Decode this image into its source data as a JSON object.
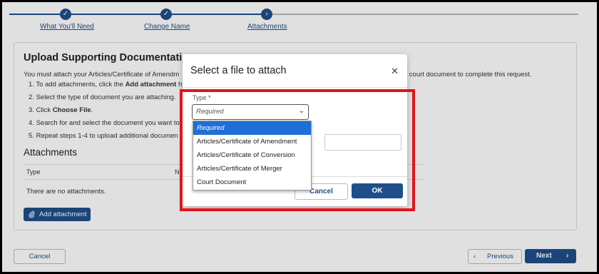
{
  "stepper": {
    "steps": [
      {
        "label": "What You'll Need",
        "state": "complete",
        "icon": "check-icon"
      },
      {
        "label": "Change Name",
        "state": "complete",
        "icon": "check-icon"
      },
      {
        "label": "Attachments",
        "state": "current",
        "icon": "chevron-right-icon"
      }
    ]
  },
  "card": {
    "title": "Upload Supporting Documentation",
    "intro_left": "You must attach your Articles/Certificate of Amendm",
    "intro_right": "r court document to complete this request.",
    "instructions": [
      {
        "number": "1.",
        "text_before": "To add attachments, click the ",
        "bold": "Add attachment",
        "text_after": " hy"
      },
      {
        "number": "2.",
        "text": "Select the type of document you are attaching."
      },
      {
        "number": "3.",
        "text_before": "Click ",
        "bold": "Choose File",
        "text_after": "."
      },
      {
        "number": "4.",
        "text": "Search for and select the document you want to"
      },
      {
        "number": "5.",
        "text": "Repeat steps 1-4 to upload additional documen"
      }
    ],
    "attachments_heading": "Attachments",
    "columns": [
      "Type",
      "N"
    ],
    "empty_message": "There are no attachments.",
    "add_button": "Add attachment"
  },
  "footer": {
    "cancel": "Cancel",
    "previous": "Previous",
    "next": "Next"
  },
  "modal": {
    "title": "Select a file to attach",
    "type_label": "Type",
    "required_mark": "*",
    "select_value": "Required",
    "options": [
      "Required",
      "Articles/Certificate of Amendment",
      "Articles/Certificate of Conversion",
      "Articles/Certificate of Merger",
      "Court Document"
    ],
    "cancel": "Cancel",
    "ok": "OK"
  },
  "colors": {
    "brand": "#1f4f8a",
    "highlight": "#e3141b",
    "selected_option": "#1f6fd6"
  }
}
